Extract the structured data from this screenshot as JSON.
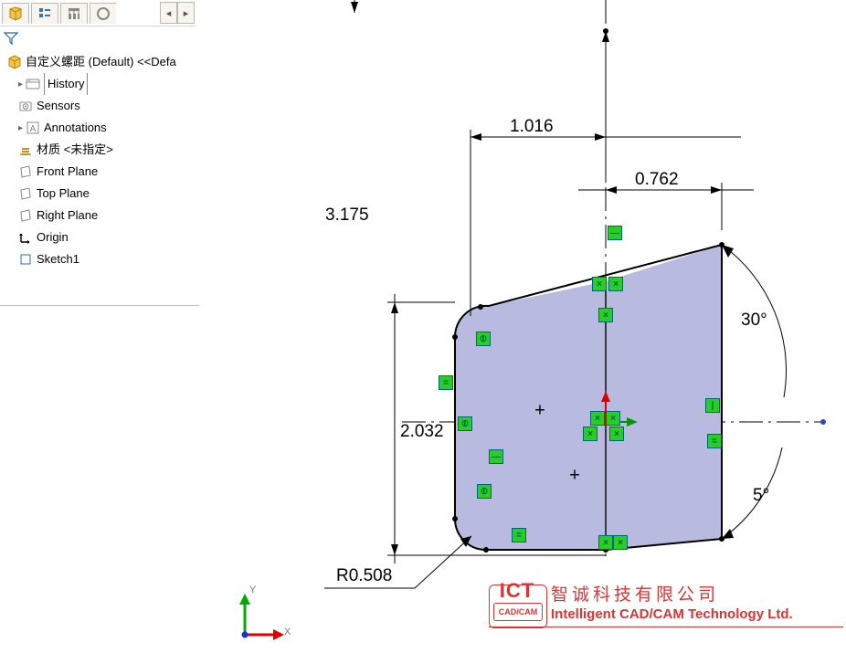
{
  "tabs": {
    "scroll_left": "◂",
    "scroll_right": "▸"
  },
  "tree": {
    "root": "自定义螺距 (Default) <<Defa",
    "history": "History",
    "sensors": "Sensors",
    "annotations": "Annotations",
    "material": "材质 <未指定>",
    "front": "Front Plane",
    "top": "Top Plane",
    "right": "Right Plane",
    "origin": "Origin",
    "sketch1": "Sketch1"
  },
  "dims": {
    "d_3_175": "3.175",
    "d_1_016": "1.016",
    "d_0_762": "0.762",
    "d_2_032": "2.032",
    "r_label": "R0.508",
    "ang30": "30°",
    "ang5": "5°"
  },
  "triad": {
    "x": "X",
    "y": "Y"
  },
  "watermark": {
    "ict": "ICT",
    "cadcam": "CAD/CAM",
    "cn": "智诚科技有限公司",
    "en": "Intelligent CAD/CAM Technology Ltd."
  }
}
